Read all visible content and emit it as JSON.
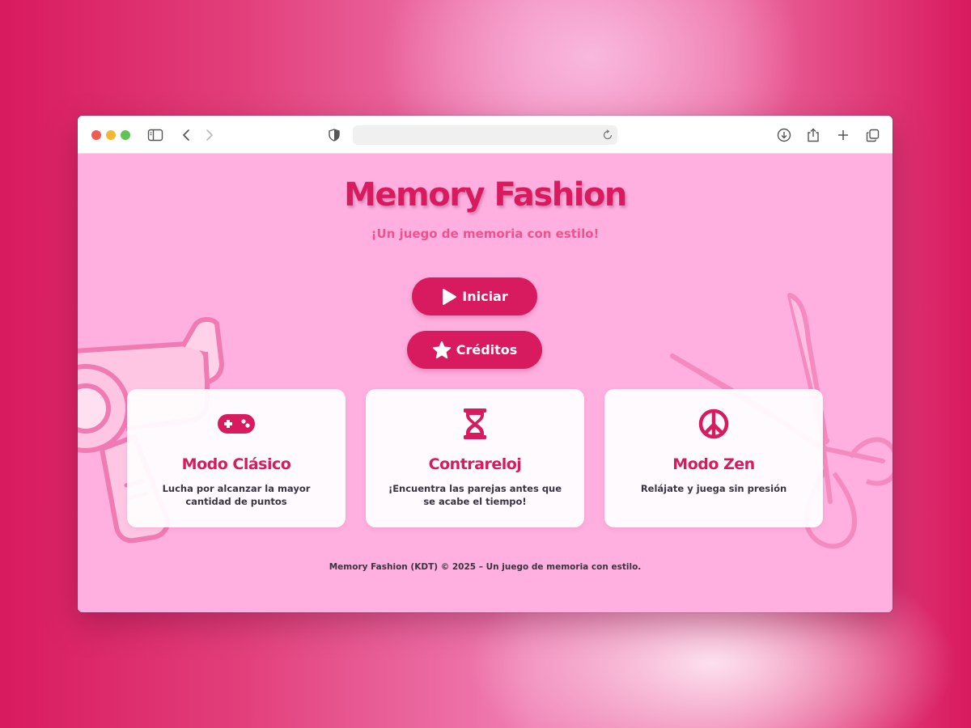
{
  "browser": {
    "url": "",
    "icons": [
      "sidebar-icon",
      "back-icon",
      "forward-icon",
      "privacy-shield-icon",
      "reload-icon",
      "download-icon",
      "share-icon",
      "new-tab-icon",
      "tabs-overview-icon"
    ]
  },
  "page": {
    "title": "Memory Fashion",
    "subtitle": "¡Un juego de memoria con estilo!",
    "buttons": {
      "play": "Iniciar",
      "credits": "Créditos"
    },
    "modes": [
      {
        "icon": "gamepad-icon",
        "title": "Modo Clásico",
        "description": "Lucha por alcanzar la mayor cantidad de puntos"
      },
      {
        "icon": "hourglass-icon",
        "title": "Contrareloj",
        "description": "¡Encuentra las parejas antes que se acabe el tiempo!"
      },
      {
        "icon": "peace-icon",
        "title": "Modo Zen",
        "description": "Relájate y juega sin presión"
      }
    ],
    "footer": "Memory Fashion (KDT) © 2025 – Un juego de memoria con estilo."
  },
  "colors": {
    "accent": "#d81a5e",
    "subtitle": "#f0528e",
    "page_background": "#ffb0e0",
    "card_background": "#ffffff",
    "text_dark": "#3a3340"
  }
}
